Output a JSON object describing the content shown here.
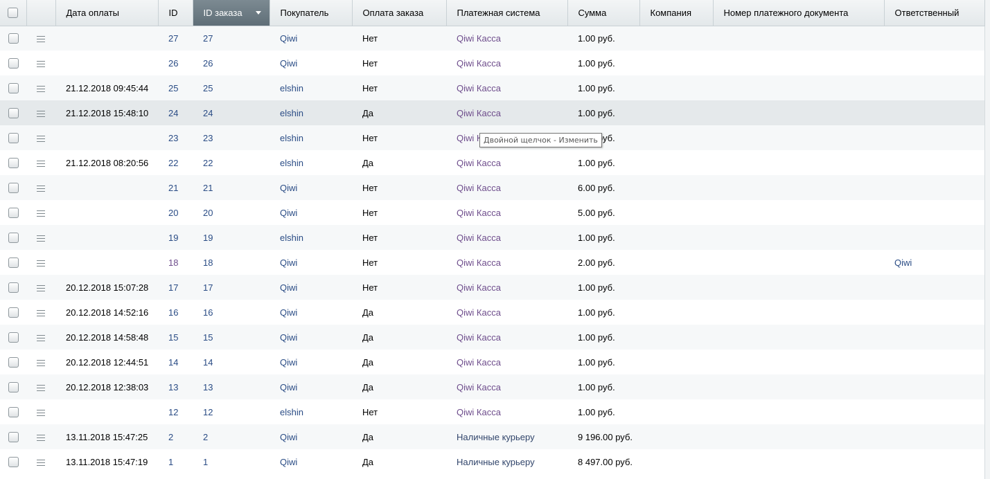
{
  "columns": [
    {
      "key": "check",
      "label": ""
    },
    {
      "key": "menu",
      "label": ""
    },
    {
      "key": "paid_date",
      "label": "Дата оплаты"
    },
    {
      "key": "id",
      "label": "ID"
    },
    {
      "key": "order_id",
      "label": "ID заказа"
    },
    {
      "key": "buyer",
      "label": "Покупатель"
    },
    {
      "key": "paid",
      "label": "Оплата заказа"
    },
    {
      "key": "pay_system",
      "label": "Платежная система"
    },
    {
      "key": "sum",
      "label": "Сумма"
    },
    {
      "key": "company",
      "label": "Компания"
    },
    {
      "key": "doc_number",
      "label": "Номер платежного документа"
    },
    {
      "key": "responsible",
      "label": "Ответственный"
    }
  ],
  "sorted_column": "order_id",
  "rows": [
    {
      "paid_date": "",
      "id": "27",
      "order_id": "27",
      "buyer": "Qiwi",
      "paid": "Нет",
      "pay_system": "Qiwi Касса",
      "sum": "1.00 руб.",
      "company": "",
      "doc_number": "",
      "responsible": ""
    },
    {
      "paid_date": "",
      "id": "26",
      "order_id": "26",
      "buyer": "Qiwi",
      "paid": "Нет",
      "pay_system": "Qiwi Касса",
      "sum": "1.00 руб.",
      "company": "",
      "doc_number": "",
      "responsible": ""
    },
    {
      "paid_date": "21.12.2018 09:45:44",
      "id": "25",
      "order_id": "25",
      "buyer": "elshin",
      "paid": "Нет",
      "pay_system": "Qiwi Касса",
      "sum": "1.00 руб.",
      "company": "",
      "doc_number": "",
      "responsible": ""
    },
    {
      "paid_date": "21.12.2018 15:48:10",
      "id": "24",
      "order_id": "24",
      "buyer": "elshin",
      "paid": "Да",
      "pay_system": "Qiwi Касса",
      "sum": "1.00 руб.",
      "company": "",
      "doc_number": "",
      "responsible": ""
    },
    {
      "paid_date": "",
      "id": "23",
      "order_id": "23",
      "buyer": "elshin",
      "paid": "Нет",
      "pay_system": "Qiwi Касса",
      "sum": "1.00 руб.",
      "company": "",
      "doc_number": "",
      "responsible": ""
    },
    {
      "paid_date": "21.12.2018 08:20:56",
      "id": "22",
      "order_id": "22",
      "buyer": "elshin",
      "paid": "Да",
      "pay_system": "Qiwi Касса",
      "sum": "1.00 руб.",
      "company": "",
      "doc_number": "",
      "responsible": ""
    },
    {
      "paid_date": "",
      "id": "21",
      "order_id": "21",
      "buyer": "Qiwi",
      "paid": "Нет",
      "pay_system": "Qiwi Касса",
      "sum": "6.00 руб.",
      "company": "",
      "doc_number": "",
      "responsible": ""
    },
    {
      "paid_date": "",
      "id": "20",
      "order_id": "20",
      "buyer": "Qiwi",
      "paid": "Нет",
      "pay_system": "Qiwi Касса",
      "sum": "5.00 руб.",
      "company": "",
      "doc_number": "",
      "responsible": ""
    },
    {
      "paid_date": "",
      "id": "19",
      "order_id": "19",
      "buyer": "elshin",
      "paid": "Нет",
      "pay_system": "Qiwi Касса",
      "sum": "1.00 руб.",
      "company": "",
      "doc_number": "",
      "responsible": ""
    },
    {
      "paid_date": "",
      "id": "18",
      "order_id": "18",
      "buyer": "Qiwi",
      "paid": "Нет",
      "pay_system": "Qiwi Касса",
      "sum": "2.00 руб.",
      "company": "",
      "doc_number": "",
      "responsible": "Qiwi"
    },
    {
      "paid_date": "20.12.2018 15:07:28",
      "id": "17",
      "order_id": "17",
      "buyer": "Qiwi",
      "paid": "Нет",
      "pay_system": "Qiwi Касса",
      "sum": "1.00 руб.",
      "company": "",
      "doc_number": "",
      "responsible": ""
    },
    {
      "paid_date": "20.12.2018 14:52:16",
      "id": "16",
      "order_id": "16",
      "buyer": "Qiwi",
      "paid": "Да",
      "pay_system": "Qiwi Касса",
      "sum": "1.00 руб.",
      "company": "",
      "doc_number": "",
      "responsible": ""
    },
    {
      "paid_date": "20.12.2018 14:58:48",
      "id": "15",
      "order_id": "15",
      "buyer": "Qiwi",
      "paid": "Да",
      "pay_system": "Qiwi Касса",
      "sum": "1.00 руб.",
      "company": "",
      "doc_number": "",
      "responsible": ""
    },
    {
      "paid_date": "20.12.2018 12:44:51",
      "id": "14",
      "order_id": "14",
      "buyer": "Qiwi",
      "paid": "Да",
      "pay_system": "Qiwi Касса",
      "sum": "1.00 руб.",
      "company": "",
      "doc_number": "",
      "responsible": ""
    },
    {
      "paid_date": "20.12.2018 12:38:03",
      "id": "13",
      "order_id": "13",
      "buyer": "Qiwi",
      "paid": "Да",
      "pay_system": "Qiwi Касса",
      "sum": "1.00 руб.",
      "company": "",
      "doc_number": "",
      "responsible": ""
    },
    {
      "paid_date": "",
      "id": "12",
      "order_id": "12",
      "buyer": "elshin",
      "paid": "Нет",
      "pay_system": "Qiwi Касса",
      "sum": "1.00 руб.",
      "company": "",
      "doc_number": "",
      "responsible": ""
    },
    {
      "paid_date": "13.11.2018 15:47:25",
      "id": "2",
      "order_id": "2",
      "buyer": "Qiwi",
      "paid": "Да",
      "pay_system": "Наличные курьеру",
      "sum": "9 196.00 руб.",
      "company": "",
      "doc_number": "",
      "responsible": ""
    },
    {
      "paid_date": "13.11.2018 15:47:19",
      "id": "1",
      "order_id": "1",
      "buyer": "Qiwi",
      "paid": "Да",
      "pay_system": "Наличные курьеру",
      "sum": "8 497.00 руб.",
      "company": "",
      "doc_number": "",
      "responsible": ""
    }
  ],
  "hover_row_index": 3,
  "tooltip": {
    "text": "Двойной щелчок - Изменить"
  },
  "icons": {
    "row_menu": "hamburger-menu-icon",
    "sort": "sort-desc-arrow-icon"
  }
}
